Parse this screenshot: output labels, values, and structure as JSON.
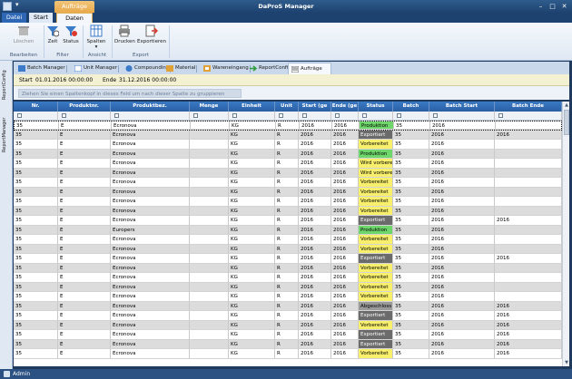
{
  "app": {
    "title": "DaProS Manager",
    "context_tab": "Aufträge"
  },
  "ribbon_tabs": {
    "file": "Datei",
    "start": "Start",
    "daten": "Daten"
  },
  "ribbon": {
    "buttons": {
      "loeschen": "Löschen",
      "zeit": "Zeit",
      "status": "Status",
      "spalten": "Spalten",
      "drucken": "Drucken",
      "exportieren": "Exportieren"
    },
    "groups": {
      "bearbeiten": "Bearbeiten",
      "filter": "Filter",
      "ansicht": "Ansicht",
      "export": "Export"
    }
  },
  "left_tabs": {
    "report_config": "ReportConfig",
    "report_manager": "ReportManager"
  },
  "doc_tabs": [
    "Batch Manager",
    "Unit Manager",
    "Compounding",
    "Material",
    "Wareneingang",
    "ReportConfig",
    "Aufträge"
  ],
  "range": {
    "start_label": "Start",
    "start_value": "01.01.2016 00:00:00",
    "end_label": "Ende",
    "end_value": "31.12.2016 00:00:00"
  },
  "group_hint": "Ziehen Sie einen Spaltenkopf in dieses Feld um nach dieser Spalte zu gruppieren",
  "columns": [
    "Nr.",
    "Produktnr.",
    "Produktbez.",
    "Menge",
    "Einheit",
    "Unit",
    "Start (ge",
    "Ende (ge",
    "Status",
    "Batch",
    "Batch Start",
    "Batch Ende"
  ],
  "rows": [
    [
      "35",
      "E",
      "Ecronova",
      "",
      "KG",
      "R",
      "2016",
      "2016",
      "Produktion",
      "35",
      "2016",
      ""
    ],
    [
      "35",
      "E",
      "Ecronova",
      "",
      "KG",
      "R",
      "2016",
      "2016",
      "Exportiert",
      "35",
      "2016",
      "2016"
    ],
    [
      "35",
      "E",
      "Ecronova",
      "",
      "KG",
      "R",
      "2016",
      "2016",
      "Vorbereitet",
      "35",
      "2016",
      ""
    ],
    [
      "35",
      "E",
      "Ecronova",
      "",
      "KG",
      "R",
      "2016",
      "2016",
      "Produktion",
      "35",
      "2016",
      ""
    ],
    [
      "35",
      "E",
      "Ecronova",
      "",
      "KG",
      "R",
      "2016",
      "2016",
      "Wird vorberei",
      "35",
      "2016",
      ""
    ],
    [
      "35",
      "E",
      "Ecronova",
      "",
      "KG",
      "R",
      "2016",
      "2016",
      "Wird vorberei",
      "35",
      "2016",
      ""
    ],
    [
      "35",
      "E",
      "Ecronova",
      "",
      "KG",
      "R",
      "2016",
      "2016",
      "Vorbereitet",
      "35",
      "2016",
      ""
    ],
    [
      "35",
      "E",
      "Ecronova",
      "",
      "KG",
      "R",
      "2016",
      "2016",
      "Vorbereitet",
      "35",
      "2016",
      ""
    ],
    [
      "35",
      "E",
      "Ecronova",
      "",
      "KG",
      "R",
      "2016",
      "2016",
      "Vorbereitet",
      "35",
      "2016",
      ""
    ],
    [
      "35",
      "E",
      "Ecronova",
      "",
      "KG",
      "R",
      "2016",
      "2016",
      "Vorbereitet",
      "35",
      "2016",
      ""
    ],
    [
      "35",
      "E",
      "Ecronova",
      "",
      "KG",
      "R",
      "2016",
      "2016",
      "Exportiert",
      "35",
      "2016",
      "2016"
    ],
    [
      "35",
      "E",
      "Europers",
      "",
      "KG",
      "R",
      "2016",
      "2016",
      "Produktion",
      "35",
      "2016",
      ""
    ],
    [
      "35",
      "E",
      "Ecronova",
      "",
      "KG",
      "R",
      "2016",
      "2016",
      "Vorbereitet",
      "35",
      "2016",
      ""
    ],
    [
      "35",
      "E",
      "Ecronova",
      "",
      "KG",
      "R",
      "2016",
      "2016",
      "Vorbereitet",
      "35",
      "2016",
      ""
    ],
    [
      "35",
      "E",
      "Ecronova",
      "",
      "KG",
      "R",
      "2016",
      "2016",
      "Exportiert",
      "35",
      "2016",
      "2016"
    ],
    [
      "35",
      "E",
      "Ecronova",
      "",
      "KG",
      "R",
      "2016",
      "2016",
      "Vorbereitet",
      "35",
      "2016",
      ""
    ],
    [
      "35",
      "E",
      "Ecronova",
      "",
      "KG",
      "R",
      "2016",
      "2016",
      "Vorbereitet",
      "35",
      "2016",
      ""
    ],
    [
      "35",
      "E",
      "Ecronova",
      "",
      "KG",
      "R",
      "2016",
      "2016",
      "Vorbereitet",
      "35",
      "2016",
      ""
    ],
    [
      "35",
      "E",
      "Ecronova",
      "",
      "KG",
      "R",
      "2016",
      "2016",
      "Vorbereitet",
      "35",
      "2016",
      ""
    ],
    [
      "35",
      "E",
      "Ecronova",
      "",
      "KG",
      "R",
      "2016",
      "2016",
      "Abgeschloss",
      "35",
      "2016",
      "2016"
    ],
    [
      "35",
      "E",
      "Ecronova",
      "",
      "KG",
      "R",
      "2016",
      "2016",
      "Exportiert",
      "35",
      "2016",
      "2016"
    ],
    [
      "35",
      "E",
      "Ecronova",
      "",
      "KG",
      "R",
      "2016",
      "2016",
      "Vorbereitet",
      "35",
      "2016",
      "2016"
    ],
    [
      "35",
      "E",
      "Ecronova",
      "",
      "KG",
      "R",
      "2016",
      "2016",
      "Exportiert",
      "35",
      "2016",
      "2016"
    ],
    [
      "35",
      "E",
      "Ecronova",
      "",
      "KG",
      "R",
      "2016",
      "2016",
      "Exportiert",
      "35",
      "2016",
      "2016"
    ],
    [
      "35",
      "E",
      "Ecronova",
      "",
      "KG",
      "R",
      "2016",
      "2016",
      "Vorbereitet",
      "35",
      "2016",
      "2016"
    ]
  ],
  "status_colors": {
    "Produktion": "#6ed66b",
    "Exportiert": "#6b6b6b",
    "Vorbereitet": "#f8f06c",
    "Wird vorberei": "#f8f06c",
    "Abgeschloss": "#9a9a9a"
  },
  "statusbar": {
    "user": "Admin"
  }
}
